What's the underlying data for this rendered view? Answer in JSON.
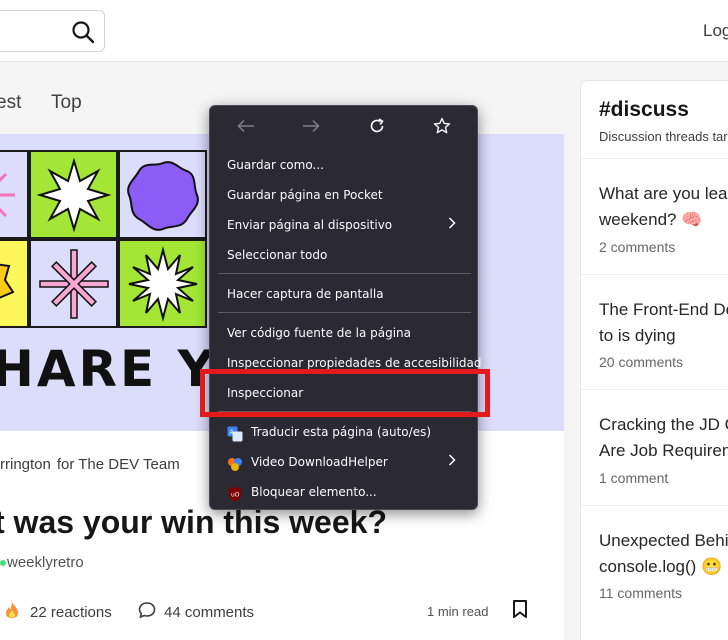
{
  "header": {
    "search_icon": "search-icon",
    "login": "Log"
  },
  "tabs": {
    "latest": "est",
    "top": "Top"
  },
  "post": {
    "banner_text": "HARE YO",
    "author": "rrington",
    "org": "for The DEV Team",
    "title": "t was your win this week?",
    "tag": "weeklyretro",
    "reactions": "22 reactions",
    "comments": "44 comments",
    "read_time": "1 min read",
    "banner_colors": {
      "lavender": "#dcdcfb",
      "lime": "#a3e635",
      "yellow": "#fef75b",
      "purple": "#8b5cf6",
      "pink": "#f9a8d4"
    }
  },
  "discuss": {
    "title": "#discuss",
    "subtitle": "Discussion threads tar",
    "threads": [
      {
        "title": "What are you lea\nweekend? 🧠",
        "count": "2 comments"
      },
      {
        "title": "The Front-End De\nto is dying",
        "count": "20 comments"
      },
      {
        "title": "Cracking the JD C\nAre Job Requirem",
        "count": "1 comment"
      },
      {
        "title": "Unexpected Behi\nconsole.log() 😬",
        "count": "11 comments"
      }
    ]
  },
  "context_menu": {
    "nav_icons": [
      "back-arrow-icon",
      "forward-arrow-icon",
      "reload-icon",
      "bookmark-star-icon"
    ],
    "items": {
      "save_as": "Guardar como...",
      "save_pocket": "Guardar página en Pocket",
      "send_device": "Enviar página al dispositivo",
      "select_all": "Seleccionar todo",
      "screenshot": "Hacer captura de pantalla",
      "view_source": "Ver código fuente de la página",
      "inspect_a11y": "Inspeccionar propiedades de accesibilidad",
      "inspect": "Inspeccionar",
      "translate": "Traducir esta página (auto/es)",
      "video_helper": "Video DownloadHelper",
      "block_element": "Bloquear elemento..."
    },
    "accent_highlight": "#e3191b"
  }
}
